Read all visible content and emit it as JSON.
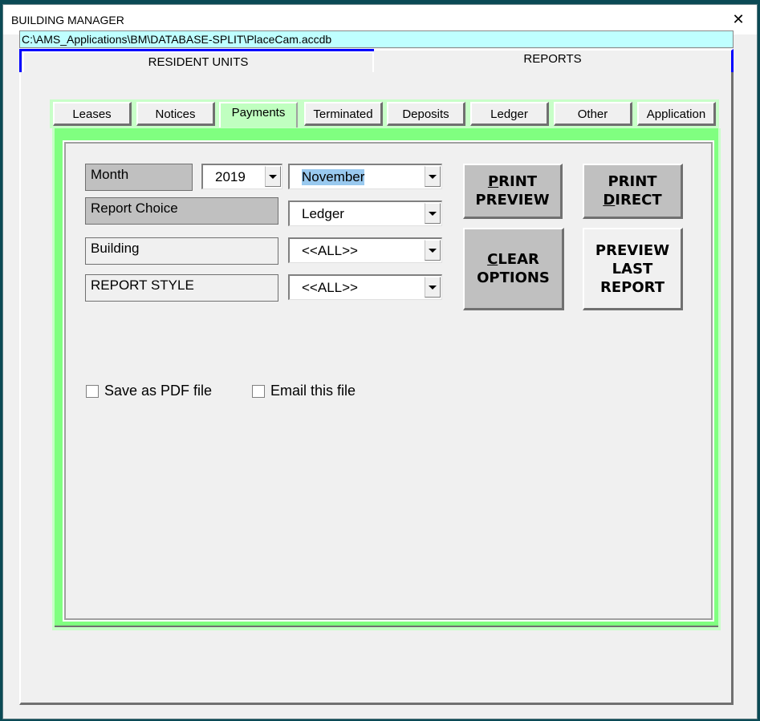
{
  "window": {
    "title": "BUILDING MANAGER",
    "close_icon": "close-icon"
  },
  "path_bar": "C:\\AMS_Applications\\BM\\DATABASE-SPLIT\\PlaceCam.accdb",
  "main_tabs": [
    {
      "label": "RESIDENT UNITS",
      "active": false
    },
    {
      "label": "REPORTS",
      "active": true
    }
  ],
  "sub_tabs": [
    {
      "label": "Leases",
      "active": false
    },
    {
      "label": "Notices",
      "active": false
    },
    {
      "label": "Payments",
      "active": true
    },
    {
      "label": "Terminated",
      "active": false
    },
    {
      "label": "Deposits",
      "active": false
    },
    {
      "label": "Ledger",
      "active": false
    },
    {
      "label": "Other",
      "active": false
    },
    {
      "label": "Application",
      "active": false
    }
  ],
  "form": {
    "month_label": "Month",
    "year_value": "2019",
    "month_value": "November",
    "report_choice_label": "Report Choice",
    "report_choice_value": "Ledger",
    "building_label": "Building",
    "building_value": "<<ALL>>",
    "report_style_label": "REPORT STYLE",
    "report_style_value": "<<ALL>>"
  },
  "buttons": {
    "print_preview": {
      "accel": "P",
      "line1_rest": "RINT",
      "line2": "PREVIEW"
    },
    "print_direct": {
      "line1": "PRINT",
      "accel": "D",
      "line2_rest": "IRECT"
    },
    "clear_options": {
      "accel": "C",
      "line1_rest": "LEAR",
      "line2": "OPTIONS"
    },
    "preview_last_report": {
      "line1": "PREVIEW",
      "line2": "LAST",
      "line3": "REPORT"
    }
  },
  "checkboxes": {
    "save_pdf": {
      "label": "Save as PDF file",
      "checked": false
    },
    "email_file": {
      "label": "Email this file",
      "checked": false
    }
  },
  "colors": {
    "path_bar_bg": "#bfffff",
    "active_tab_bg": "#c0ffc0",
    "frame_green": "#80ff80",
    "selection_highlight": "#99c9ef",
    "tab_accent_blue": "#0000ff"
  }
}
